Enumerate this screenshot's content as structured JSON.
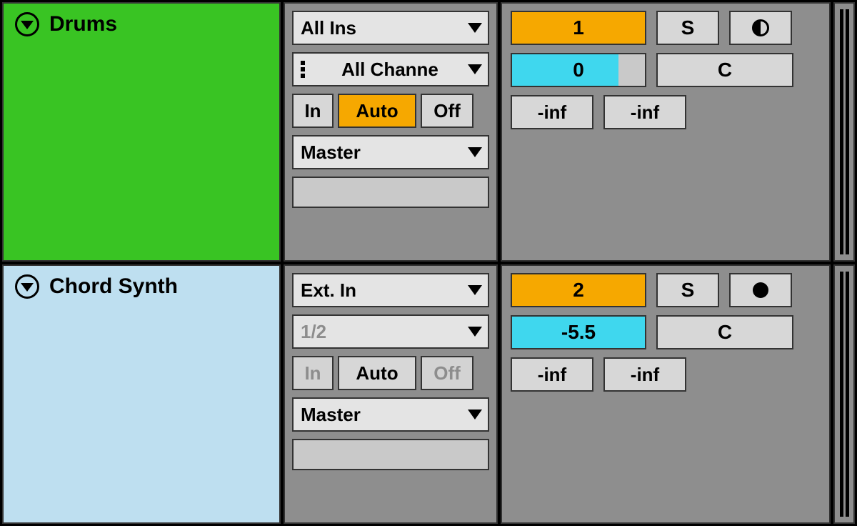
{
  "tracks": [
    {
      "name": "Drums",
      "header_color": "green",
      "io": {
        "input_type": "All Ins",
        "input_channel": "All Channe",
        "input_channel_has_icon": true,
        "monitor_in": "In",
        "monitor_auto": "Auto",
        "monitor_off": "Off",
        "monitor_active": "auto",
        "output": "Master"
      },
      "mixer": {
        "track_number": "1",
        "solo": "S",
        "volume": "0",
        "volume_fill_pct": 80,
        "cue": "C",
        "send_a": "-inf",
        "send_b": "-inf",
        "rec_style": "half"
      }
    },
    {
      "name": "Chord Synth",
      "header_color": "lightblue",
      "io": {
        "input_type": "Ext. In",
        "input_channel": "1/2",
        "input_channel_disabled": true,
        "monitor_in": "In",
        "monitor_auto": "Auto",
        "monitor_off": "Off",
        "monitor_active": "none",
        "output": "Master"
      },
      "mixer": {
        "track_number": "2",
        "solo": "S",
        "volume": "-5.5",
        "volume_fill_pct": 100,
        "cue": "C",
        "send_a": "-inf",
        "send_b": "-inf",
        "rec_style": "full"
      }
    }
  ]
}
